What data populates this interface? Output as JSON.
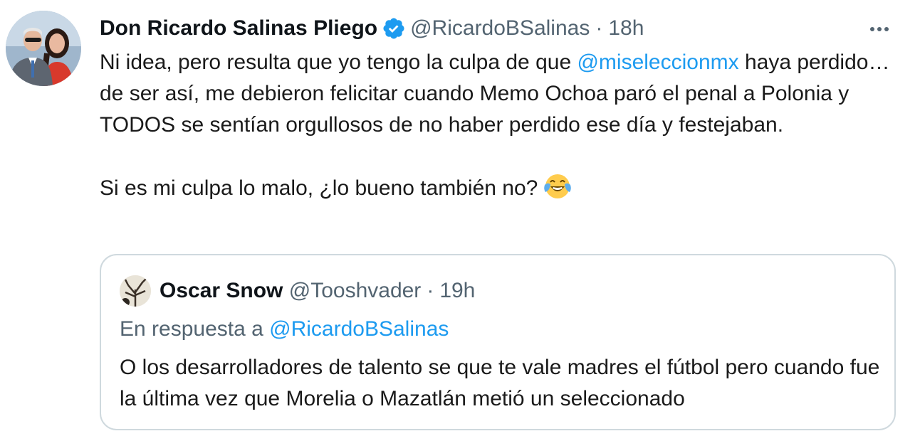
{
  "tweet": {
    "author_name": "Don Ricardo Salinas Pliego",
    "handle": "@RicardoBSalinas",
    "separator": "·",
    "time": "18h",
    "verified_icon": "verified-badge-icon",
    "more_icon": "more-options-icon",
    "body": {
      "p1_before": "Ni idea, pero resulta que yo tengo la culpa de que ",
      "p1_mention": "@miseleccionmx",
      "p1_after": " haya perdido… de ser así, me debieron felicitar cuando Memo Ochoa paró el penal a Polonia y TODOS se sentían orgullosos de no haber perdido ese día y festejaban.",
      "p2": "Si es mi culpa lo malo, ¿lo bueno también no?",
      "p2_emoji": "face-with-tears-of-joy-emoji"
    }
  },
  "quoted_tweet": {
    "author_name": "Oscar Snow",
    "handle": "@Tooshvader",
    "separator": "·",
    "time": "19h",
    "reply_prefix": "En respuesta a ",
    "reply_mention": "@RicardoBSalinas",
    "text": "O los desarrolladores de talento se que te vale madres el fútbol pero cuando fue la última vez que Morelia o Mazatlán metió un seleccionado"
  },
  "colors": {
    "link": "#1d9bf0",
    "secondary_text": "#536471",
    "border": "#cfd9de",
    "verified": "#1d9bf0"
  }
}
